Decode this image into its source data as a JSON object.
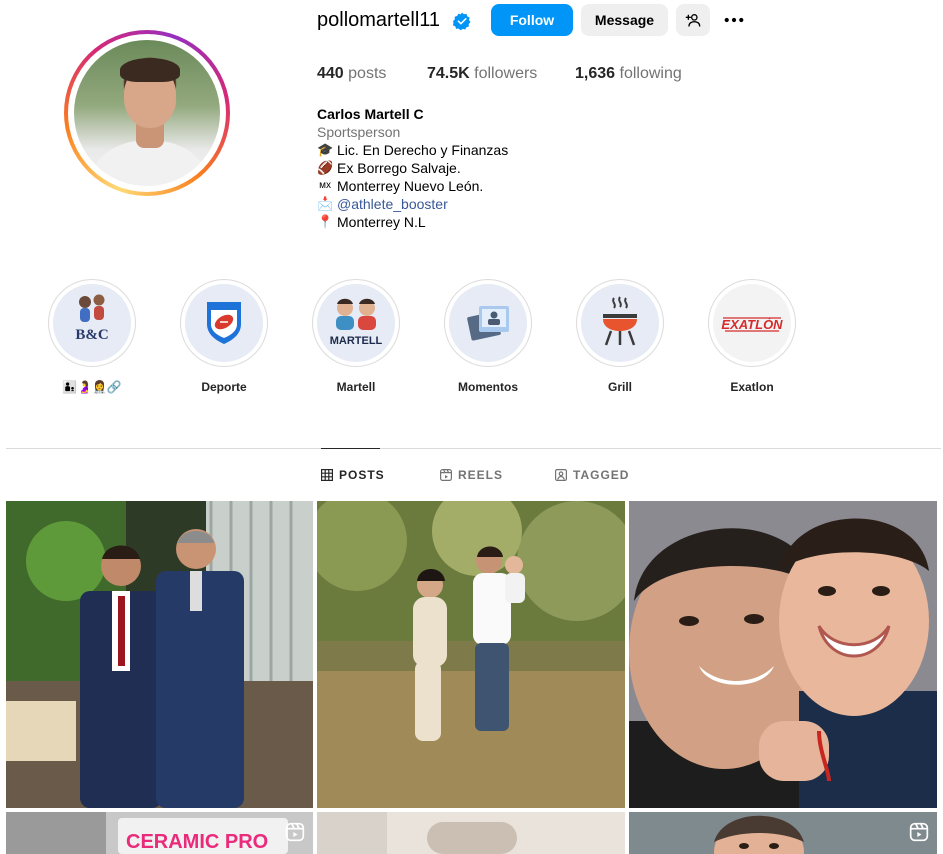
{
  "profile": {
    "username": "pollomartell11",
    "follow_label": "Follow",
    "message_label": "Message",
    "stats": {
      "posts_count": "440",
      "posts_label": "posts",
      "followers_count": "74.5K",
      "followers_label": "followers",
      "following_count": "1,636",
      "following_label": "following"
    },
    "full_name": "Carlos Martell C",
    "category": "Sportsperson",
    "bio_lines": [
      {
        "icon": "🎓",
        "text": "Lic. En Derecho y Finanzas"
      },
      {
        "icon": "🏈",
        "text": "Ex Borrego Salvaje."
      },
      {
        "icon": "ᴍx",
        "text": "Monterrey Nuevo León."
      },
      {
        "icon": "📩",
        "text": "@athlete_booster"
      },
      {
        "icon": "📍",
        "text": "Monterrey N.L"
      }
    ]
  },
  "highlights": [
    {
      "label": "👨‍👦🤰👩‍⚕️🔗",
      "icon": "bc-family-icon"
    },
    {
      "label": "Deporte",
      "icon": "football-shield-icon"
    },
    {
      "label": "Martell",
      "icon": "martell-brothers-icon"
    },
    {
      "label": "Momentos",
      "icon": "photos-icon"
    },
    {
      "label": "Grill",
      "icon": "grill-icon"
    },
    {
      "label": "Exatlon",
      "icon": "exatlon-logo-icon"
    }
  ],
  "highlight_texts": {
    "bc": "B&C",
    "martell": "MARTELL",
    "exatlon": "EXATLÓN"
  },
  "tabs": [
    {
      "label": "POSTS",
      "icon": "grid-icon",
      "active": true
    },
    {
      "label": "REELS",
      "icon": "reels-icon",
      "active": false
    },
    {
      "label": "TAGGED",
      "icon": "tagged-icon",
      "active": false
    }
  ],
  "posts": {
    "ceramic_sign": "CERAMIC PRO"
  },
  "colors": {
    "accent": "#0095f6",
    "verified": "#0095f6",
    "link": "#385898"
  }
}
